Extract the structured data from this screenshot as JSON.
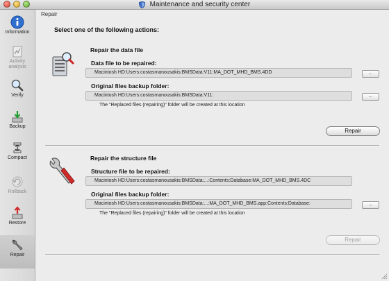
{
  "window": {
    "title": "Maintenance and security center"
  },
  "sidebar": {
    "items": [
      {
        "label": "Information",
        "icon": "info-icon",
        "state": "enabled"
      },
      {
        "label": "Activity analysis",
        "icon": "activity-analysis-icon",
        "state": "disabled"
      },
      {
        "label": "Verify",
        "icon": "magnifier-icon",
        "state": "enabled"
      },
      {
        "label": "Backup",
        "icon": "backup-icon",
        "state": "enabled"
      },
      {
        "label": "Compact",
        "icon": "compact-icon",
        "state": "enabled"
      },
      {
        "label": "Rollback",
        "icon": "rollback-icon",
        "state": "disabled"
      },
      {
        "label": "Restore",
        "icon": "restore-icon",
        "state": "enabled"
      },
      {
        "label": "Repair",
        "icon": "wrench-icon",
        "state": "selected"
      }
    ]
  },
  "main": {
    "breadcrumb": "Repair",
    "heading": "Select one of the following actions:",
    "data_file": {
      "title": "Repair the data file",
      "file_label": "Data file to be repaired:",
      "file_path": "Macintosh HD:Users:costasmanousakis:BMSData:V11:MA_DOT_MHD_BMS.4DD",
      "backup_label": "Original files backup folder:",
      "backup_path": "Macintosh HD:Users:costasmanousakis:BMSData:V11:",
      "browse_label": "...",
      "note": "The \"Replaced files (repairing)\" folder will be created at this location",
      "button": "Repair",
      "button_enabled": true
    },
    "structure_file": {
      "title": "Repair the structure file",
      "file_label": "Structure file to be repaired:",
      "file_path": "Macintosh HD:Users:costasmanousakis:BMSData:...:Contents:Database:MA_DOT_MHD_BMS.4DC",
      "backup_label": "Original files backup folder:",
      "backup_path": "Macintosh HD:Users:costasmanousakis:BMSData:...:MA_DOT_MHD_BMS.app:Contents:Database:",
      "browse_label": "...",
      "note": "The \"Replaced files (repairing)\" folder will be created at this location",
      "button": "Repair",
      "button_enabled": false
    }
  },
  "colors": {
    "accent_blue": "#2f6fd0",
    "wrench_red": "#d02a2a"
  }
}
